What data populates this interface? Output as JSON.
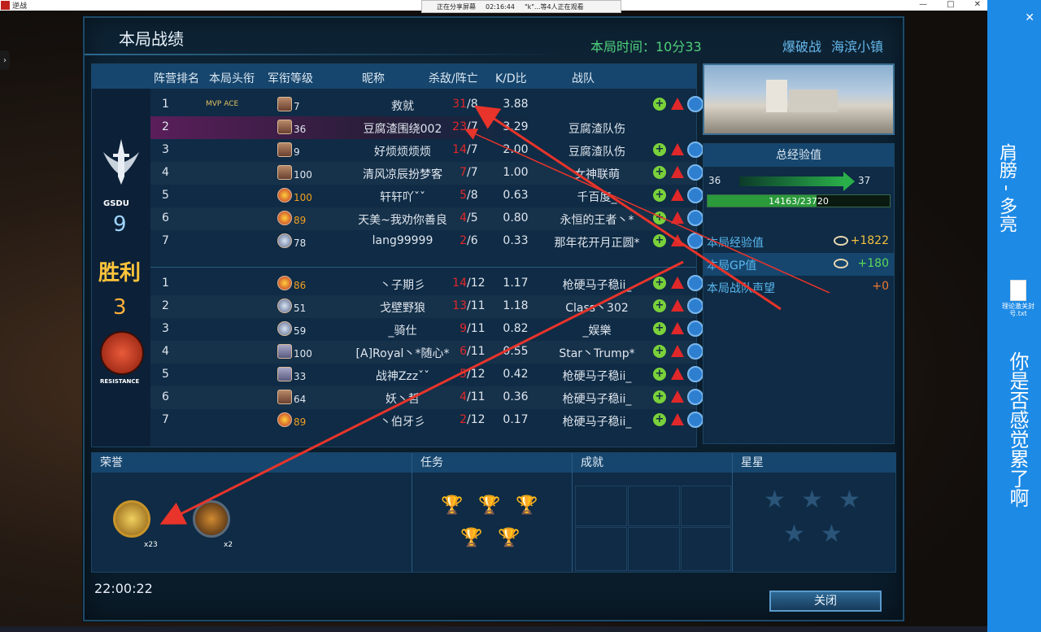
{
  "os": {
    "window_title": "逆战",
    "share_status": "正在分享屏幕",
    "share_time": "02:16:44",
    "viewers": "\"k\"...等4人正在观看",
    "min": "—",
    "max": "□",
    "close": "✕"
  },
  "side": {
    "close": "✕",
    "text_a": "肩膀 - 多亮",
    "file_name": "理论激关封号.txt",
    "text_b": "你是否感觉累了啊"
  },
  "dialog": {
    "title": "本局战绩",
    "match_time": "本局时间：10分33",
    "mode": "爆破战",
    "map": "海滨小镇"
  },
  "columns": [
    "阵营排名",
    "本局头衔",
    "军衔等级",
    "昵称",
    "杀敌/阵亡",
    "K/D比",
    "战队"
  ],
  "team_a": {
    "tag": "GSDU",
    "score": "9",
    "result": "胜利"
  },
  "team_b": {
    "tag": "RESISTANCE",
    "score": "3"
  },
  "rows_a": [
    {
      "rank": "1",
      "title": "MVP  ACE",
      "lvl": "7",
      "nick": "救就",
      "kills": "31",
      "deaths": "/8",
      "kd": "3.88",
      "team": ""
    },
    {
      "rank": "2",
      "title": "",
      "lvl": "36",
      "nick": "豆腐渣围绕002",
      "kills": "23",
      "deaths": "/7",
      "kd": "3.29",
      "team": "豆腐渣队伤"
    },
    {
      "rank": "3",
      "title": "",
      "lvl": "9",
      "nick": "好烦烦烦烦",
      "kills": "14",
      "deaths": "/7",
      "kd": "2.00",
      "team": "豆腐渣队伤"
    },
    {
      "rank": "4",
      "title": "",
      "lvl": "100",
      "nick": "清风凉辰扮梦客",
      "kills": "7",
      "deaths": "/7",
      "kd": "1.00",
      "team": "女神联萌"
    },
    {
      "rank": "5",
      "title": "",
      "lvl": "100",
      "nick": "轩轩吖ˇˇ",
      "kills": "5",
      "deaths": "/8",
      "kd": "0.63",
      "team": "千百度_"
    },
    {
      "rank": "6",
      "title": "",
      "lvl": "89",
      "nick": "天美~我劝你善良",
      "kills": "4",
      "deaths": "/5",
      "kd": "0.80",
      "team": "永恒的王者丶*"
    },
    {
      "rank": "7",
      "title": "",
      "lvl": "78",
      "nick": "lang99999",
      "kills": "2",
      "deaths": "/6",
      "kd": "0.33",
      "team": "那年花开月正圆*"
    }
  ],
  "rows_b": [
    {
      "rank": "1",
      "title": "",
      "lvl": "86",
      "nick": "丶子期彡",
      "kills": "14",
      "deaths": "/12",
      "kd": "1.17",
      "team": "枪硬马子稳ii_"
    },
    {
      "rank": "2",
      "title": "",
      "lvl": "51",
      "nick": "戈壁野狼",
      "kills": "13",
      "deaths": "/11",
      "kd": "1.18",
      "team": "Class丶302"
    },
    {
      "rank": "3",
      "title": "",
      "lvl": "59",
      "nick": "_骑仕",
      "kills": "9",
      "deaths": "/11",
      "kd": "0.82",
      "team": "_娱樂"
    },
    {
      "rank": "4",
      "title": "",
      "lvl": "100",
      "nick": "[A]Royal丶*随心*",
      "kills": "6",
      "deaths": "/11",
      "kd": "0.55",
      "team": "Star丶Trump*"
    },
    {
      "rank": "5",
      "title": "",
      "lvl": "33",
      "nick": "战神Zzzˇˇ",
      "kills": "5",
      "deaths": "/12",
      "kd": "0.42",
      "team": "枪硬马子稳ii_"
    },
    {
      "rank": "6",
      "title": "",
      "lvl": "64",
      "nick": "妖丶哲",
      "kills": "4",
      "deaths": "/11",
      "kd": "0.36",
      "team": "枪硬马子稳ii_"
    },
    {
      "rank": "7",
      "title": "",
      "lvl": "89",
      "nick": "丶伯牙彡",
      "kills": "2",
      "deaths": "/12",
      "kd": "0.17",
      "team": "枪硬马子稳ii_"
    }
  ],
  "xp": {
    "title": "总经验值",
    "from_lvl": "36",
    "to_lvl": "37",
    "progress": "14163/23720",
    "fraction": 0.597,
    "rows": [
      {
        "label": "本局经验值",
        "value": "+1822"
      },
      {
        "label": "本局GP值",
        "value": "+180"
      },
      {
        "label": "本局战队声望",
        "value": "+0"
      }
    ]
  },
  "sections": {
    "honor": "荣誉",
    "honor_counts": [
      "x23",
      "x2"
    ],
    "tasks": "任务",
    "achievements": "成就",
    "stars": "星星"
  },
  "clock": "22:00:22",
  "close_label": "关闭"
}
